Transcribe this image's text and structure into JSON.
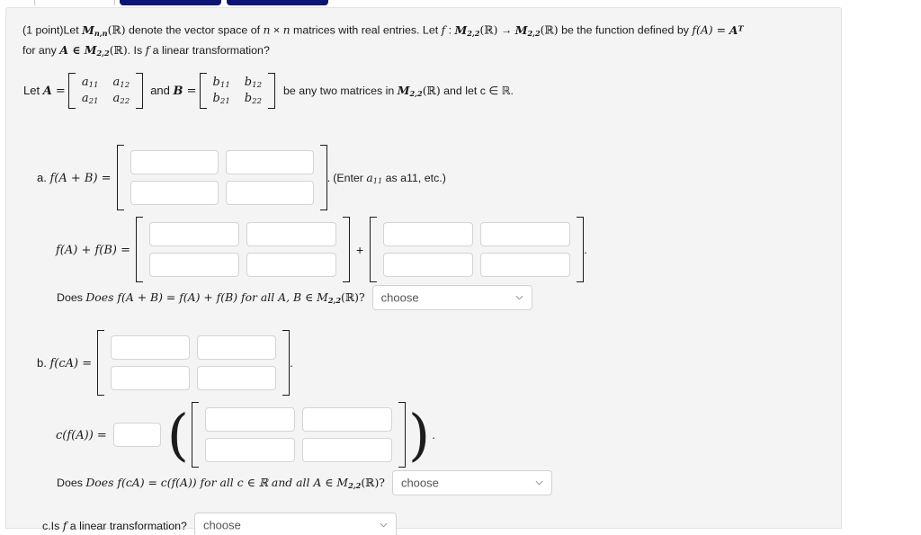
{
  "toolbar": {
    "field_name": "answer-entry-field",
    "button1_name": "preview-answers-button",
    "button2_name": "submit-answers-button"
  },
  "problem": {
    "points_label": "(1 point)",
    "intro_line1_a": "Let ",
    "intro_M": "M",
    "intro_M_sub": "n,n",
    "intro_R": "(ℝ)",
    "intro_line1_b": " denote the vector space of ",
    "intro_n1": "n",
    "intro_times": " × ",
    "intro_n2": "n",
    "intro_line1_c": " matrices with real entries. Let ",
    "intro_f": "f",
    "intro_colon": " : ",
    "intro_M22a": "M",
    "intro_M22a_sub": "2,2",
    "intro_arrow": " → ",
    "intro_line1_d": " be the function defined by ",
    "intro_fA": "f(A)",
    "intro_eq": " = ",
    "intro_AT": "A",
    "intro_T": "T",
    "intro_line2_a": "for any ",
    "intro_A_in": "A ∈ ",
    "intro_line2_b": ". Is ",
    "intro_line2_c": " a linear transformation?",
    "let_A_label": "Let A =",
    "matrix_A": [
      [
        "a",
        "a"
      ],
      [
        "a",
        "a"
      ]
    ],
    "matrix_A_subs": [
      [
        "11",
        "12"
      ],
      [
        "21",
        "22"
      ]
    ],
    "and_label": "and B =",
    "matrix_B": [
      [
        "b",
        "b"
      ],
      [
        "b",
        "b"
      ]
    ],
    "matrix_B_subs": [
      [
        "11",
        "12"
      ],
      [
        "21",
        "22"
      ]
    ],
    "be_any_two": "be any two matrices in",
    "M22_tail": "and let c ∈ ℝ."
  },
  "part_a": {
    "label_a": "a.",
    "label_expr": "f(A + B) =",
    "inputs": [
      [
        "",
        ""
      ],
      [
        "",
        ""
      ]
    ],
    "period": ".",
    "hint_pre": "(Enter ",
    "hint_a": "a",
    "hint_a_sub": "11",
    "hint_post": " as a11, etc.)",
    "sum_label": "f(A) + f(B) =",
    "sum_inputs_left": [
      [
        "",
        ""
      ],
      [
        "",
        ""
      ]
    ],
    "plus": "+",
    "sum_inputs_right": [
      [
        "",
        ""
      ],
      [
        "",
        ""
      ]
    ],
    "sum_period": ".",
    "question": "Does f(A + B) = f(A) + f(B) for all A, B ∈ M",
    "question_sub": "2,2",
    "question_tail": "(ℝ)?",
    "dropdown_value": "choose"
  },
  "part_b": {
    "label_b": "b.",
    "label_expr": "f(cA) =",
    "inputs": [
      [
        "",
        ""
      ],
      [
        "",
        ""
      ]
    ],
    "period": ".",
    "scalar_label": "c(f(A)) =",
    "scalar_value": "",
    "scalar_inputs": [
      [
        "",
        ""
      ],
      [
        "",
        ""
      ]
    ],
    "scalar_period": ".",
    "question": "Does f(cA) = c(f(A)) for all c ∈ ℝ and all A ∈ M",
    "question_sub": "2,2",
    "question_tail": "(ℝ)?",
    "dropdown_value": "choose"
  },
  "part_c": {
    "label_c": "c.",
    "question_pre": "Is ",
    "question_f": "f",
    "question_post": " a linear transformation?",
    "dropdown_value": "choose"
  },
  "colors": {
    "panel_bg": "#f4f4f4",
    "button_navy": "#0b1475",
    "input_border": "#d4d4d4",
    "text": "#1a1a1a"
  }
}
